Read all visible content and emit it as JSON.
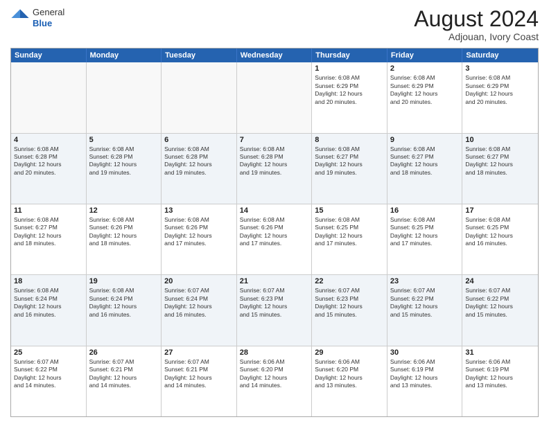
{
  "header": {
    "logo_line1": "General",
    "logo_line2": "Blue",
    "title": "August 2024",
    "subtitle": "Adjouan, Ivory Coast"
  },
  "weekdays": [
    "Sunday",
    "Monday",
    "Tuesday",
    "Wednesday",
    "Thursday",
    "Friday",
    "Saturday"
  ],
  "rows": [
    {
      "alt": false,
      "cells": [
        {
          "day": "",
          "text": ""
        },
        {
          "day": "",
          "text": ""
        },
        {
          "day": "",
          "text": ""
        },
        {
          "day": "",
          "text": ""
        },
        {
          "day": "1",
          "text": "Sunrise: 6:08 AM\nSunset: 6:29 PM\nDaylight: 12 hours\nand 20 minutes."
        },
        {
          "day": "2",
          "text": "Sunrise: 6:08 AM\nSunset: 6:29 PM\nDaylight: 12 hours\nand 20 minutes."
        },
        {
          "day": "3",
          "text": "Sunrise: 6:08 AM\nSunset: 6:29 PM\nDaylight: 12 hours\nand 20 minutes."
        }
      ]
    },
    {
      "alt": true,
      "cells": [
        {
          "day": "4",
          "text": "Sunrise: 6:08 AM\nSunset: 6:28 PM\nDaylight: 12 hours\nand 20 minutes."
        },
        {
          "day": "5",
          "text": "Sunrise: 6:08 AM\nSunset: 6:28 PM\nDaylight: 12 hours\nand 19 minutes."
        },
        {
          "day": "6",
          "text": "Sunrise: 6:08 AM\nSunset: 6:28 PM\nDaylight: 12 hours\nand 19 minutes."
        },
        {
          "day": "7",
          "text": "Sunrise: 6:08 AM\nSunset: 6:28 PM\nDaylight: 12 hours\nand 19 minutes."
        },
        {
          "day": "8",
          "text": "Sunrise: 6:08 AM\nSunset: 6:27 PM\nDaylight: 12 hours\nand 19 minutes."
        },
        {
          "day": "9",
          "text": "Sunrise: 6:08 AM\nSunset: 6:27 PM\nDaylight: 12 hours\nand 18 minutes."
        },
        {
          "day": "10",
          "text": "Sunrise: 6:08 AM\nSunset: 6:27 PM\nDaylight: 12 hours\nand 18 minutes."
        }
      ]
    },
    {
      "alt": false,
      "cells": [
        {
          "day": "11",
          "text": "Sunrise: 6:08 AM\nSunset: 6:27 PM\nDaylight: 12 hours\nand 18 minutes."
        },
        {
          "day": "12",
          "text": "Sunrise: 6:08 AM\nSunset: 6:26 PM\nDaylight: 12 hours\nand 18 minutes."
        },
        {
          "day": "13",
          "text": "Sunrise: 6:08 AM\nSunset: 6:26 PM\nDaylight: 12 hours\nand 17 minutes."
        },
        {
          "day": "14",
          "text": "Sunrise: 6:08 AM\nSunset: 6:26 PM\nDaylight: 12 hours\nand 17 minutes."
        },
        {
          "day": "15",
          "text": "Sunrise: 6:08 AM\nSunset: 6:25 PM\nDaylight: 12 hours\nand 17 minutes."
        },
        {
          "day": "16",
          "text": "Sunrise: 6:08 AM\nSunset: 6:25 PM\nDaylight: 12 hours\nand 17 minutes."
        },
        {
          "day": "17",
          "text": "Sunrise: 6:08 AM\nSunset: 6:25 PM\nDaylight: 12 hours\nand 16 minutes."
        }
      ]
    },
    {
      "alt": true,
      "cells": [
        {
          "day": "18",
          "text": "Sunrise: 6:08 AM\nSunset: 6:24 PM\nDaylight: 12 hours\nand 16 minutes."
        },
        {
          "day": "19",
          "text": "Sunrise: 6:08 AM\nSunset: 6:24 PM\nDaylight: 12 hours\nand 16 minutes."
        },
        {
          "day": "20",
          "text": "Sunrise: 6:07 AM\nSunset: 6:24 PM\nDaylight: 12 hours\nand 16 minutes."
        },
        {
          "day": "21",
          "text": "Sunrise: 6:07 AM\nSunset: 6:23 PM\nDaylight: 12 hours\nand 15 minutes."
        },
        {
          "day": "22",
          "text": "Sunrise: 6:07 AM\nSunset: 6:23 PM\nDaylight: 12 hours\nand 15 minutes."
        },
        {
          "day": "23",
          "text": "Sunrise: 6:07 AM\nSunset: 6:22 PM\nDaylight: 12 hours\nand 15 minutes."
        },
        {
          "day": "24",
          "text": "Sunrise: 6:07 AM\nSunset: 6:22 PM\nDaylight: 12 hours\nand 15 minutes."
        }
      ]
    },
    {
      "alt": false,
      "cells": [
        {
          "day": "25",
          "text": "Sunrise: 6:07 AM\nSunset: 6:22 PM\nDaylight: 12 hours\nand 14 minutes."
        },
        {
          "day": "26",
          "text": "Sunrise: 6:07 AM\nSunset: 6:21 PM\nDaylight: 12 hours\nand 14 minutes."
        },
        {
          "day": "27",
          "text": "Sunrise: 6:07 AM\nSunset: 6:21 PM\nDaylight: 12 hours\nand 14 minutes."
        },
        {
          "day": "28",
          "text": "Sunrise: 6:06 AM\nSunset: 6:20 PM\nDaylight: 12 hours\nand 14 minutes."
        },
        {
          "day": "29",
          "text": "Sunrise: 6:06 AM\nSunset: 6:20 PM\nDaylight: 12 hours\nand 13 minutes."
        },
        {
          "day": "30",
          "text": "Sunrise: 6:06 AM\nSunset: 6:19 PM\nDaylight: 12 hours\nand 13 minutes."
        },
        {
          "day": "31",
          "text": "Sunrise: 6:06 AM\nSunset: 6:19 PM\nDaylight: 12 hours\nand 13 minutes."
        }
      ]
    }
  ]
}
